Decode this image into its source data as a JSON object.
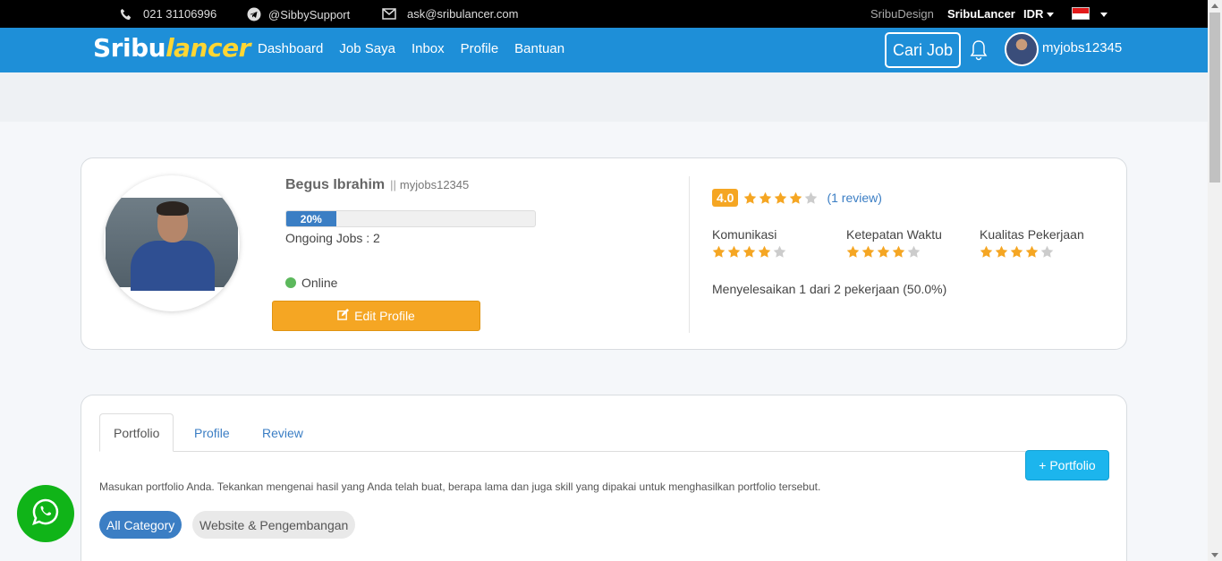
{
  "topbar": {
    "phone": "021 31106996",
    "telegram": "@SibbySupport",
    "email": "ask@sribulancer.com",
    "sribu_design": "SribuDesign",
    "sribu_lancer": "SribuLancer",
    "currency": "IDR"
  },
  "nav": {
    "logo_a": "Sribu",
    "logo_b": "lancer",
    "links": [
      "Dashboard",
      "Job Saya",
      "Inbox",
      "Profile",
      "Bantuan"
    ],
    "cari_job": "Cari Job",
    "username": "myjobs12345"
  },
  "profile": {
    "name": "Begus Ibrahim",
    "separator": "||",
    "username": "myjobs12345",
    "progress_label": "20%",
    "progress_value": 0.2,
    "ongoing": "Ongoing Jobs : 2",
    "status": "Online",
    "edit_label": "Edit Profile",
    "rating": "4.0",
    "rating_stars": 4,
    "review_link": "(1 review)",
    "criteria": [
      {
        "label": "Komunikasi",
        "stars": 4
      },
      {
        "label": "Ketepatan Waktu",
        "stars": 4
      },
      {
        "label": "Kualitas Pekerjaan",
        "stars": 4
      }
    ],
    "completion": "Menyelesaikan 1 dari 2 pekerjaan (50.0%)"
  },
  "portfolio": {
    "tabs": [
      "Portfolio",
      "Profile",
      "Review"
    ],
    "add_button": "+ Portfolio",
    "description": "Masukan portfolio Anda. Tekankan mengenai hasil yang Anda telah buat, berapa lama dan juga skill yang dipakai untuk menghasilkan portfolio tersebut.",
    "categories": [
      "All Category",
      "Website & Pengembangan"
    ]
  },
  "colors": {
    "nav": "#1e8fd8",
    "accent_orange": "#f5a623",
    "link_blue": "#3b7ec4",
    "whatsapp": "#10b418"
  }
}
